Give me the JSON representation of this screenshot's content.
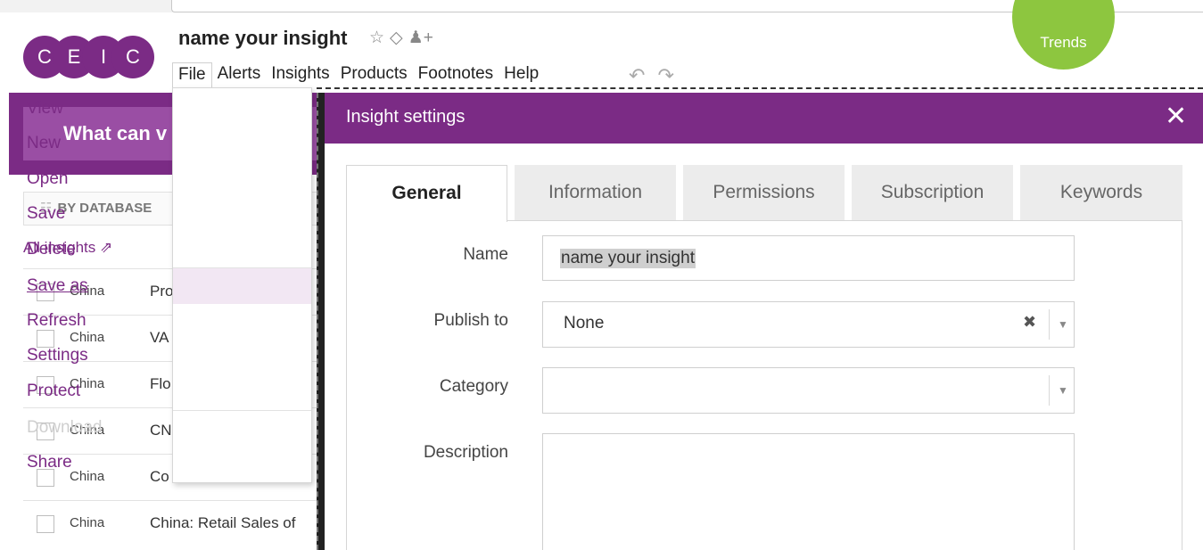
{
  "app": {
    "logo_letters": [
      "C",
      "E",
      "I",
      "C"
    ],
    "insight_title": "name your insight",
    "title_icons": {
      "star": "☆",
      "tag": "⌂",
      "share_user": "👤+"
    },
    "trends_label": "Trends"
  },
  "menubar": {
    "items": [
      "File",
      "Alerts",
      "Insights",
      "Products",
      "Footnotes",
      "Help"
    ],
    "undo_icon": "↶",
    "redo_icon": "↷"
  },
  "file_menu": {
    "items": [
      {
        "label": "View",
        "state": "normal"
      },
      {
        "label": "New",
        "state": "normal"
      },
      {
        "label": "Open",
        "state": "normal"
      },
      {
        "label": "Save",
        "state": "normal"
      },
      {
        "label": "Delete",
        "state": "normal"
      },
      {
        "label": "Save as",
        "state": "hover"
      },
      {
        "label": "Refresh",
        "state": "normal"
      },
      {
        "label": "Settings",
        "state": "normal"
      },
      {
        "label": "Protect",
        "state": "normal"
      },
      {
        "label": "Download",
        "state": "disabled"
      },
      {
        "label": "Share",
        "state": "normal"
      }
    ]
  },
  "left_panel": {
    "banner": "What can v",
    "tab_label": "BY DATABASE",
    "all_insights": "All insights ⇗",
    "rows": [
      {
        "country": "China",
        "desc": "Pro"
      },
      {
        "country": "China",
        "desc": "VA"
      },
      {
        "country": "China",
        "desc": "Flo"
      },
      {
        "country": "China",
        "desc": "CN"
      },
      {
        "country": "China",
        "desc": "Co"
      },
      {
        "country": "China",
        "desc": "China: Retail Sales of"
      }
    ]
  },
  "dialog": {
    "title": "Insight settings",
    "close": "✕",
    "tabs": [
      "General",
      "Information",
      "Permissions",
      "Subscription",
      "Keywords"
    ],
    "active_tab": "General",
    "fields": {
      "name_label": "Name",
      "name_value": "name your insight",
      "publish_label": "Publish to",
      "publish_value": "None",
      "clear_icon": "✖",
      "dropdown_icon": "▼",
      "category_label": "Category",
      "category_value": "",
      "description_label": "Description",
      "description_value": ""
    }
  },
  "colors": {
    "brand_purple": "#7b2b85",
    "trends_green": "#8dc63f",
    "banner_purple": "#9a4ea4"
  }
}
